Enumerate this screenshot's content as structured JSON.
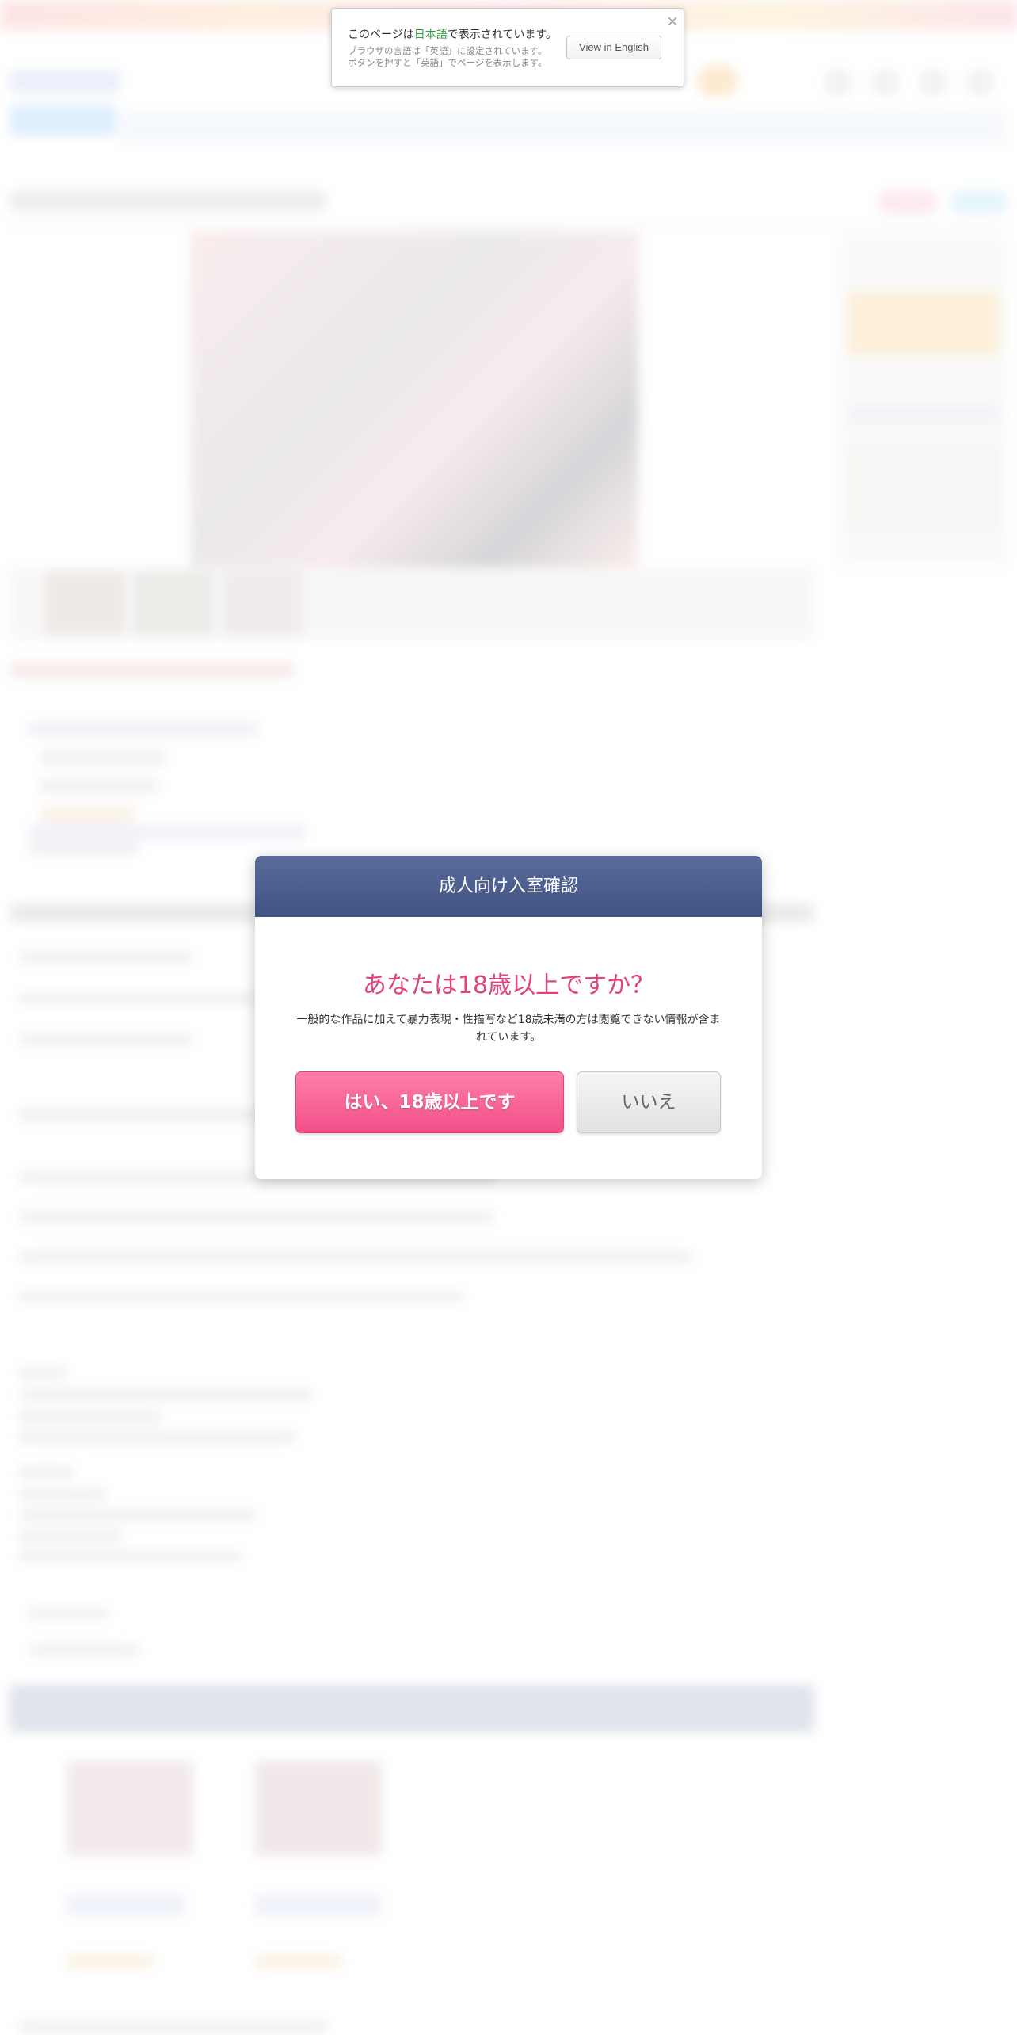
{
  "language_notice": {
    "prefix": "このページは",
    "language": "日本語",
    "suffix": "で表示されています。",
    "sub_line1": "ブラウザの言語は「英語」に設定されています。",
    "sub_line2": "ボタンを押すと「英語」でページを表示します。",
    "button_label": "View in English",
    "close_icon": "close-icon",
    "accent_color": "#2e9b3e"
  },
  "age_modal": {
    "title": "成人向け入室確認",
    "question": "あなたは18歳以上ですか？",
    "note": "一般的な作品に加えて暴力表現・性描写など18歳未満の方は閲覧できない情報が含まれています。",
    "yes_label": "はい、18歳以上です",
    "no_label": "いいえ",
    "header_color": "#3f5283",
    "question_color": "#e2427e",
    "yes_color": "#f24f89"
  }
}
